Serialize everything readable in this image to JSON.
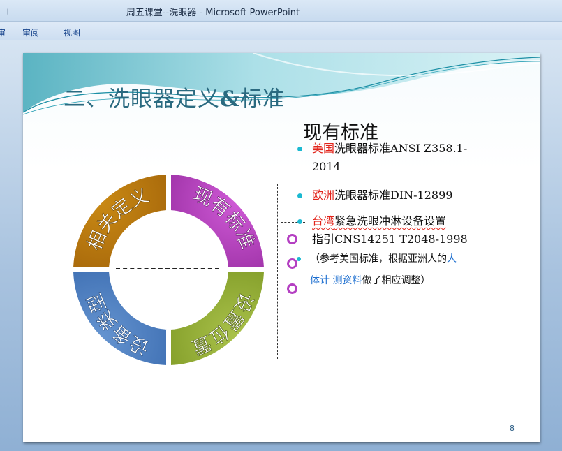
{
  "window": {
    "title": "周五课堂--洗眼器 - Microsoft PowerPoint",
    "tabs": [
      "审阅",
      "视图"
    ]
  },
  "slide": {
    "title_prefix": "二、洗眼器定义",
    "title_amp": "&",
    "title_suffix": "标准",
    "standards_heading": "现有标准",
    "standards": [
      {
        "region": "美国",
        "text": "洗眼器标准ANSI Z358.1-",
        "text2": "2014"
      },
      {
        "region": "欧洲",
        "text": "洗眼器标准DIN-12899"
      },
      {
        "region": "台湾",
        "text": "紧急洗眼冲淋设备设置",
        "text2": "指引CNS14251 T2048-1998"
      }
    ],
    "note": {
      "line1_a": "（参考美国标准，根据亚洲人的",
      "line1_b": "人",
      "line2_a": "体计 测资料",
      "line2_b": "做了相应调整）"
    },
    "ring_segments": [
      "相关定义",
      "现有标准",
      "设置位置",
      "设备类型"
    ],
    "page_number": "8"
  },
  "colors": {
    "segment_orange": "#b97609",
    "segment_magenta": "#b641be",
    "segment_green": "#97b134",
    "segment_blue": "#4f82c4",
    "bullet_dot": "#1bb9d1",
    "highlight_red": "#e2231a",
    "highlight_blue": "#1d6fd0"
  }
}
